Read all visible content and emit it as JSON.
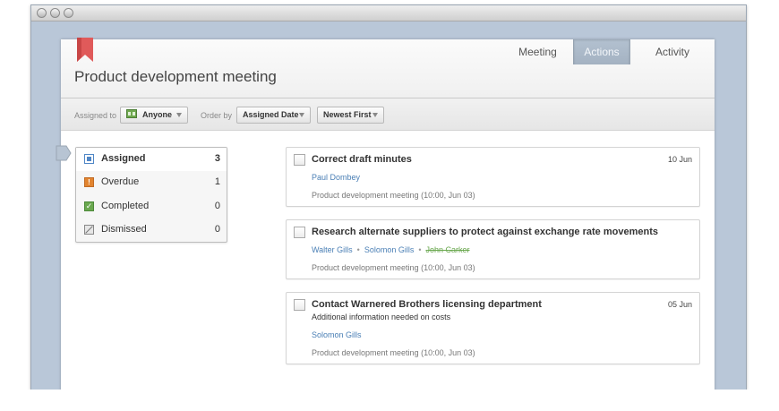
{
  "window": {
    "buttons": [
      "close",
      "minimize",
      "zoom"
    ]
  },
  "header": {
    "title": "Product development meeting",
    "icon": "bookmark-icon",
    "tabs": [
      {
        "label": "Meeting",
        "active": false
      },
      {
        "label": "Actions",
        "active": true
      },
      {
        "label": "Activity",
        "active": false
      }
    ]
  },
  "filters": {
    "assigned_label": "Assigned to",
    "assigned_value": "Anyone",
    "order_label": "Order by",
    "order_value": "Assigned Date",
    "sort_value": "Newest First"
  },
  "statuses": [
    {
      "label": "Assigned",
      "count": "3",
      "icon": "assigned-icon",
      "active": true
    },
    {
      "label": "Overdue",
      "count": "1",
      "icon": "overdue-icon",
      "active": false
    },
    {
      "label": "Completed",
      "count": "0",
      "icon": "completed-icon",
      "active": false
    },
    {
      "label": "Dismissed",
      "count": "0",
      "icon": "dismissed-icon",
      "active": false
    }
  ],
  "actions": [
    {
      "title": "Correct draft minutes",
      "date": "10 Jun",
      "note": "",
      "people": [
        "Paul Dombey"
      ],
      "struck": [],
      "meeting": "Product development meeting (10:00, Jun 03)"
    },
    {
      "title": "Research alternate suppliers to protect against exchange rate movements",
      "date": "",
      "note": "",
      "people": [
        "Walter Gills",
        "Solomon Gills",
        "John Carker"
      ],
      "struck": [
        "John Carker"
      ],
      "meeting": "Product development meeting (10:00, Jun 03)"
    },
    {
      "title": "Contact Warnered Brothers licensing department",
      "date": "05 Jun",
      "note": "Additional information needed on costs",
      "people": [
        "Solomon Gills"
      ],
      "struck": [],
      "meeting": "Product development meeting (10:00, Jun 03)"
    }
  ],
  "colors": {
    "accent_blue": "#4a7fb5",
    "active_tab": "#a8b6c6",
    "struck_green": "#6aa84f",
    "bookmark_red": "#e05a5a"
  }
}
